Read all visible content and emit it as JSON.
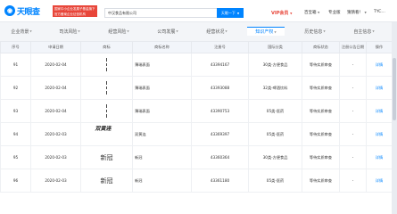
{
  "header": {
    "logo_text": "天眼查",
    "badge_lines": [
      "国家中小企业发展子基金旗下",
      "官方备案企业征信机构"
    ],
    "search_value": "中汉食品有限公司",
    "search_button": "天眼一下",
    "vip": "VIP会员",
    "nav": [
      "百宝箱",
      "专业版",
      "猜猜看！",
      "TYC…"
    ]
  },
  "tabs": [
    "企业背景",
    "司法风险",
    "经营风险",
    "公司发展",
    "经营状况",
    "知识产权",
    "历史信息",
    "自主信息"
  ],
  "active_tab_index": 5,
  "table": {
    "columns": [
      "序号",
      "申请日期",
      "商标",
      "商标名称",
      "注册号",
      "国际分类",
      "商标状态",
      "注册公告日期",
      "操作"
    ],
    "rows": [
      {
        "idx": "91",
        "date": "2020-02-04",
        "name": "薄瑞表面",
        "reg": "43394167",
        "cls": "30类-方便食品",
        "status": "等待实质审查",
        "ann": "-",
        "op": "详情"
      },
      {
        "idx": "92",
        "date": "2020-02-04",
        "name": "薄瑞表面",
        "reg": "43393088",
        "cls": "32类-啤酒饮料",
        "status": "等待实质审查",
        "ann": "-",
        "op": "详情"
      },
      {
        "idx": "93",
        "date": "2020-02-04",
        "name": "薄瑞表面",
        "reg": "43390753",
        "cls": "05类-医药",
        "status": "等待实质审查",
        "ann": "-",
        "op": "详情"
      },
      {
        "idx": "94",
        "date": "2020-02-03",
        "name": "双黄连",
        "reg": "43369397",
        "cls": "05类-医药",
        "status": "等待实质审查",
        "ann": "-",
        "op": "详情",
        "mark": "双黄连"
      },
      {
        "idx": "95",
        "date": "2020-02-03",
        "name": "新冠",
        "reg": "43360364",
        "cls": "30类-方便食品",
        "status": "等待实质审查",
        "ann": "-",
        "op": "详情",
        "mark": "新冠"
      },
      {
        "idx": "96",
        "date": "2020-02-03",
        "name": "新冠",
        "reg": "43361180",
        "cls": "05类-医药",
        "status": "等待实质审查",
        "ann": "-",
        "op": "详情",
        "mark": "新冠"
      }
    ]
  }
}
